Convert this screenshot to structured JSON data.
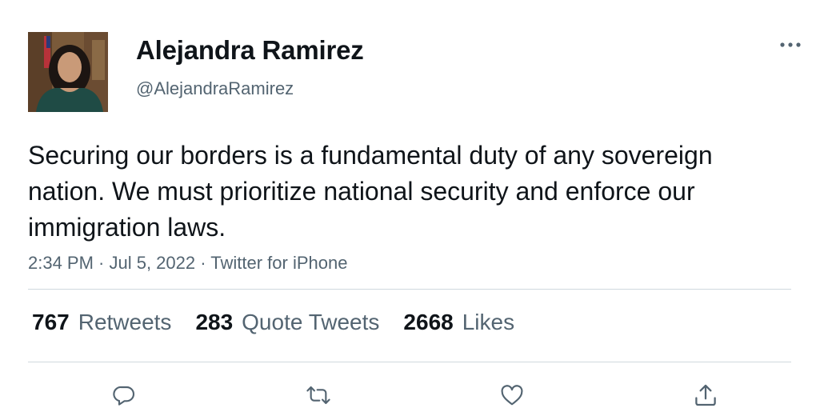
{
  "author": {
    "display_name": "Alejandra Ramirez",
    "handle": "@AlejandraRamirez"
  },
  "tweet": {
    "text": "Securing our borders is a fundamental duty of any sovereign nation. We must prioritize national security and enforce our immigration laws.",
    "meta": "2:34 PM · Jul 5, 2022 · Twitter for iPhone"
  },
  "stats": [
    {
      "count": "767",
      "label": "Retweets"
    },
    {
      "count": "283",
      "label": "Quote Tweets"
    },
    {
      "count": "2668",
      "label": "Likes"
    }
  ],
  "icons": {
    "more": "more-horizontal-icon",
    "reply": "reply-bubble-icon",
    "retweet": "retweet-icon",
    "like": "heart-icon",
    "share": "share-upload-icon"
  },
  "colors": {
    "text_primary": "#0f1419",
    "text_secondary": "#536471",
    "divider": "#cfd9de"
  }
}
